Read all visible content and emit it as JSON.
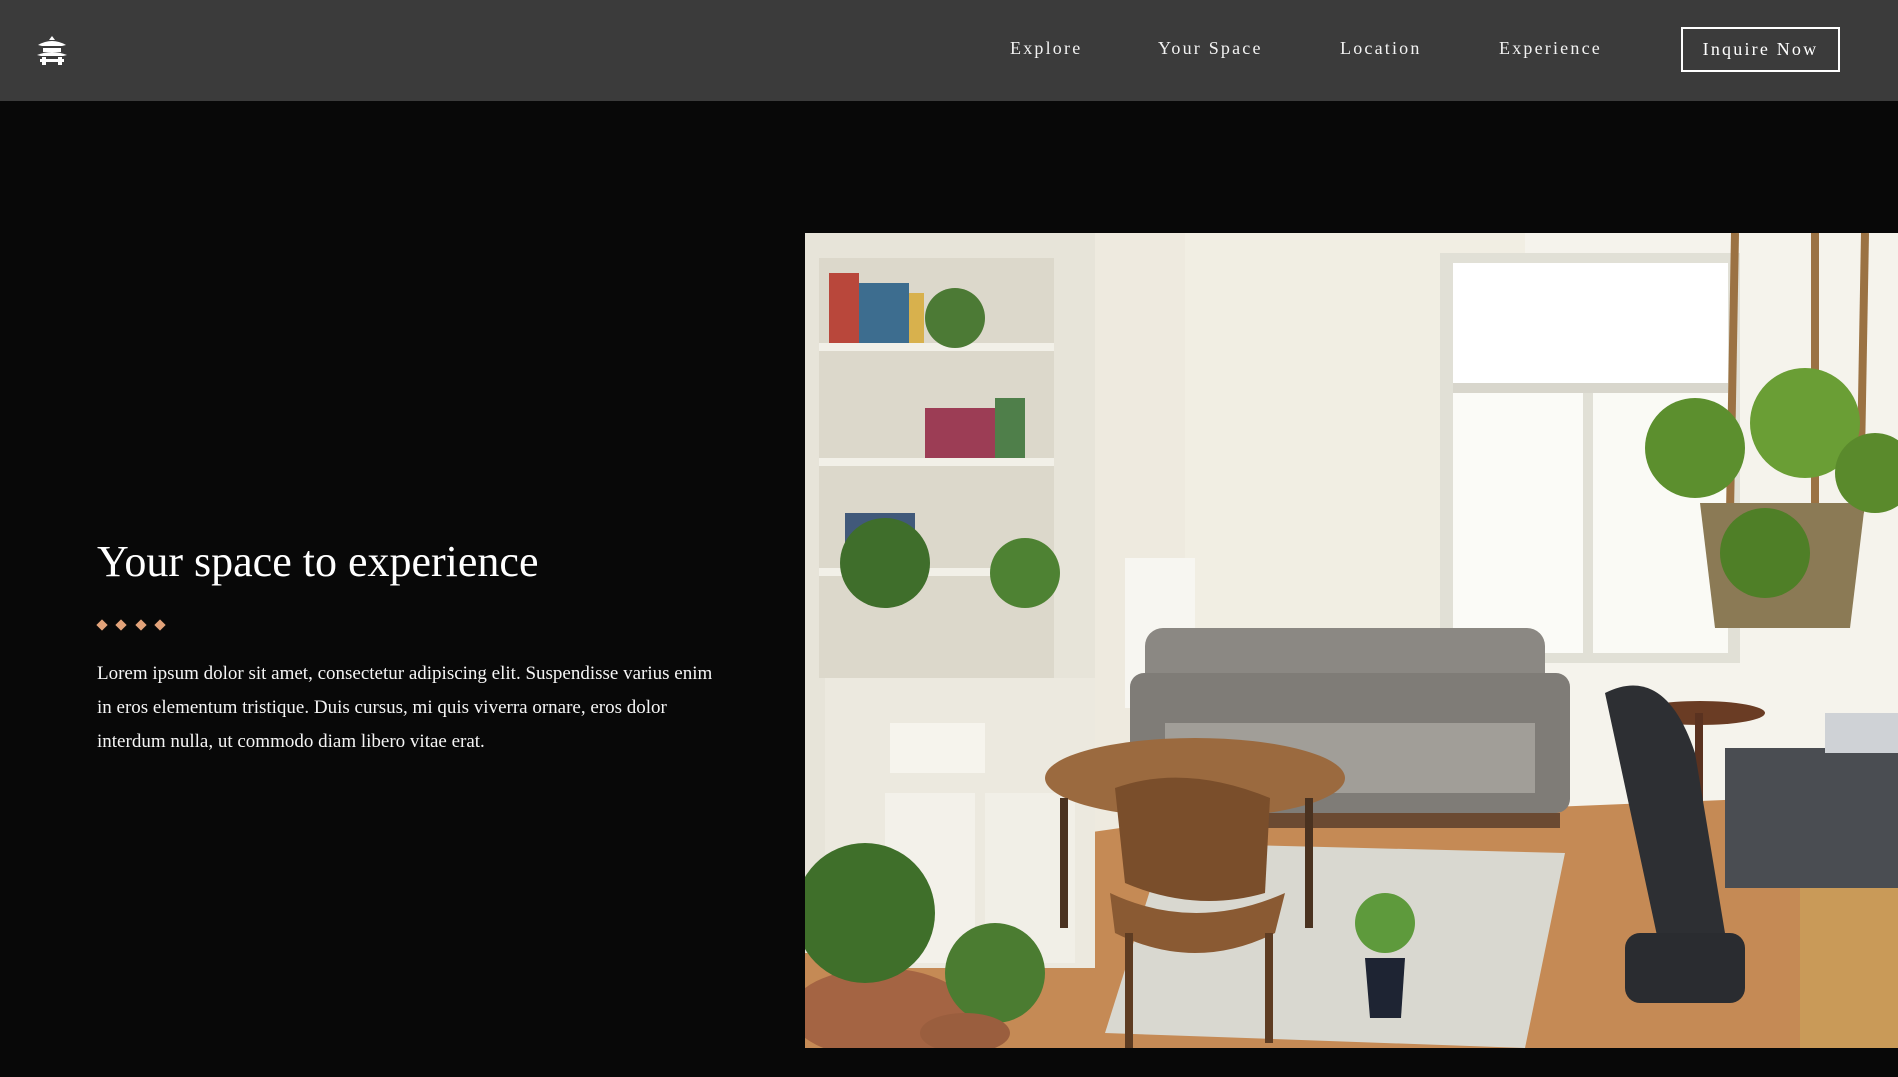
{
  "nav": {
    "logo_icon": "pagoda-icon",
    "links": [
      "Explore",
      "Your Space",
      "Location",
      "Experience"
    ],
    "cta_label": "Inquire Now"
  },
  "hero": {
    "title": "Your space to experience",
    "divider_icon": "diamond-divider-icon",
    "body": "Lorem ipsum dolor sit amet, consectetur adipiscing elit. Suspendisse varius enim in eros elementum tristique. Duis cursus, mi quis viverra ornare, eros dolor interdum nulla, ut commodo diam libero vitae erat.",
    "image_subject": "living-room-photo"
  },
  "colors": {
    "nav_bg": "#3b3b3b",
    "page_bg": "#080808",
    "accent": "#e3a37a",
    "text": "#ffffff"
  }
}
